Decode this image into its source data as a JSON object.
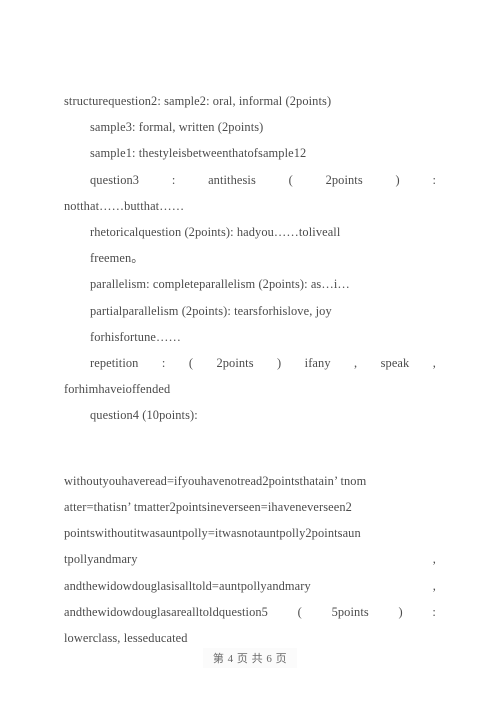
{
  "document": {
    "lines": [
      {
        "id": "l1",
        "indent": false,
        "justify": false,
        "text": "structurequestion2: sample2: oral, informal (2points)"
      },
      {
        "id": "l2",
        "indent": true,
        "justify": false,
        "text": "sample3: formal, written (2points)"
      },
      {
        "id": "l3",
        "indent": true,
        "justify": false,
        "text": "sample1: thestyleisbetweenthatofsample12"
      },
      {
        "id": "l4",
        "indent": true,
        "justify": true,
        "segments": [
          "question3",
          ":",
          "antithesis",
          "(",
          "2points",
          ")",
          ":"
        ]
      },
      {
        "id": "l5",
        "indent": false,
        "justify": false,
        "text": "notthat……butthat……"
      },
      {
        "id": "l6",
        "indent": true,
        "justify": false,
        "text": "rhetoricalquestion (2points): hadyou……toliveall"
      },
      {
        "id": "l7",
        "indent": true,
        "justify": false,
        "text": "freemen。"
      },
      {
        "id": "l8",
        "indent": true,
        "justify": false,
        "text": "parallelism: completeparallelism (2points): as…i…"
      },
      {
        "id": "l9",
        "indent": true,
        "justify": false,
        "text": "partialparallelism (2points): tearsforhislove, joy"
      },
      {
        "id": "l10",
        "indent": true,
        "justify": false,
        "text": "forhisfortune……"
      },
      {
        "id": "l11",
        "indent": true,
        "justify": true,
        "segments": [
          "repetition",
          ":",
          "(",
          "2points",
          ")",
          "ifany",
          ",",
          "speak",
          ","
        ]
      },
      {
        "id": "l12",
        "indent": false,
        "justify": false,
        "text": "forhimhaveioffended"
      },
      {
        "id": "l13",
        "indent": true,
        "justify": false,
        "text": "question4 (10points):"
      },
      {
        "id": "l14",
        "indent": false,
        "justify": false,
        "text": "",
        "blank": true
      },
      {
        "id": "l15",
        "indent": false,
        "justify": false,
        "text": "withoutyouhaveread=ifyouhavenotread2pointsthatain’ tnom"
      },
      {
        "id": "l16",
        "indent": false,
        "justify": false,
        "text": "atter=thatisn’ tmatter2pointsineverseen=ihaveneverseen2"
      },
      {
        "id": "l17",
        "indent": false,
        "justify": false,
        "text": "pointswithoutitwasauntpolly=itwasnotauntpolly2pointsaun"
      },
      {
        "id": "l18",
        "indent": false,
        "justify": true,
        "segments": [
          "tpollyandmary",
          ","
        ]
      },
      {
        "id": "l19",
        "indent": false,
        "justify": true,
        "segments": [
          "andthewidowdouglasisalltold=auntpollyandmary",
          ","
        ]
      },
      {
        "id": "l20",
        "indent": false,
        "justify": true,
        "segments": [
          "andthewidowdouglasarealltoldquestion5",
          "(",
          "5points",
          ")",
          ":"
        ]
      },
      {
        "id": "l21",
        "indent": false,
        "justify": false,
        "text": "lowerclass, lesseducated"
      }
    ]
  },
  "footer": {
    "page_label": "第 4 页  共 6 页",
    "current_page": "4",
    "total_pages": "6"
  },
  "colors": {
    "text": "#4b4b4b",
    "footer_text": "#6a6a6a",
    "page_background": "#ffffff",
    "footer_band": "#fbfbfb"
  }
}
